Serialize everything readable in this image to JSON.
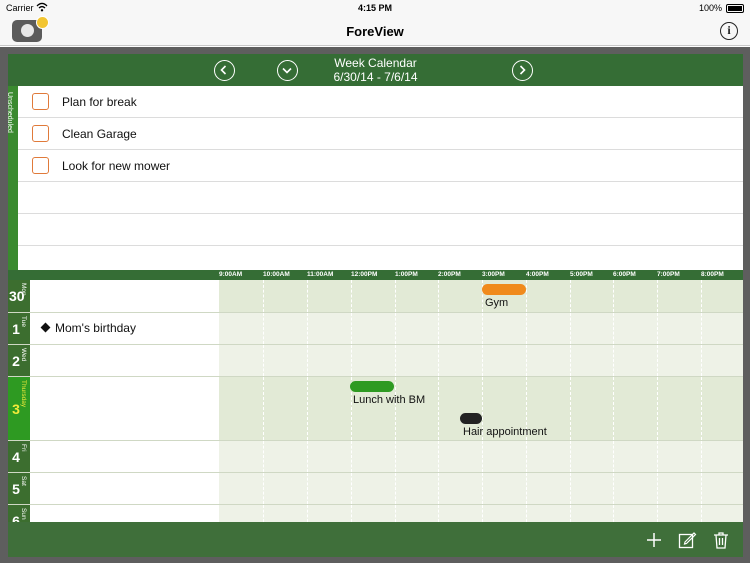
{
  "status_bar": {
    "carrier": "Carrier",
    "time": "4:15 PM",
    "battery": "100%"
  },
  "navbar": {
    "title": "ForeView",
    "info_label": "i"
  },
  "week": {
    "title": "Week Calendar",
    "range": "6/30/14 - 7/6/14"
  },
  "unscheduled": {
    "label": "Unscheduled",
    "tasks": [
      {
        "label": "Plan for break",
        "checked": false
      },
      {
        "label": "Clean Garage",
        "checked": false
      },
      {
        "label": "Look for new mower",
        "checked": false
      }
    ]
  },
  "time_header": [
    "9:00AM",
    "10:00AM",
    "11:00AM",
    "12:00PM",
    "1:00PM",
    "2:00PM",
    "3:00PM",
    "4:00PM",
    "5:00PM",
    "6:00PM",
    "7:00PM",
    "8:00PM"
  ],
  "days": [
    {
      "num": "30",
      "name": "Mon"
    },
    {
      "num": "1",
      "name": "Tue",
      "all_day": "Mom's birthday"
    },
    {
      "num": "2",
      "name": "Wed"
    },
    {
      "num": "3",
      "name": "Thursday"
    },
    {
      "num": "4",
      "name": "Fri"
    },
    {
      "num": "5",
      "name": "Sat"
    },
    {
      "num": "6",
      "name": "Sun"
    }
  ],
  "events": [
    {
      "label": "Gym",
      "color": "#f08a1c"
    },
    {
      "label": "Lunch with BM",
      "color": "#2e9a22"
    },
    {
      "label": "Hair appointment",
      "color": "#222222"
    }
  ],
  "colors": {
    "header_green": "#356d35",
    "accent_green": "#2e9a22",
    "today_text": "#f2ea3a",
    "checkbox": "#e07a3a"
  },
  "toolbar_icons": [
    "add-icon",
    "edit-icon",
    "trash-icon"
  ]
}
